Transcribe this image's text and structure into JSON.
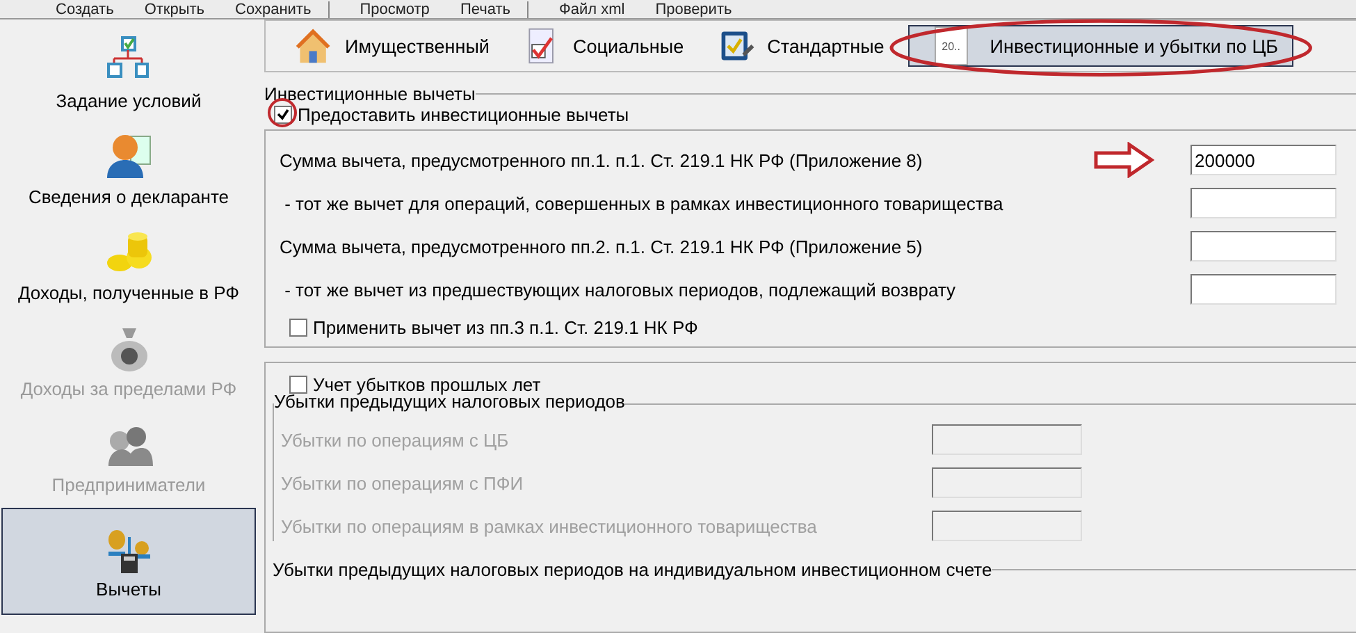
{
  "toolbar": [
    {
      "label": "Создать"
    },
    {
      "label": "Открыть"
    },
    {
      "label": "Сохранить",
      "separator_after": true
    },
    {
      "label": "Просмотр"
    },
    {
      "label": "Печать",
      "separator_after": true
    },
    {
      "label": "Файл xml"
    },
    {
      "label": "Проверить"
    }
  ],
  "sidebar": {
    "items": [
      {
        "label": "Задание условий",
        "selected": false,
        "disabled": false
      },
      {
        "label": "Сведения о декларанте",
        "selected": false,
        "disabled": false
      },
      {
        "label": "Доходы, полученные в РФ",
        "selected": false,
        "disabled": false
      },
      {
        "label": "Доходы за пределами РФ",
        "selected": false,
        "disabled": true
      },
      {
        "label": "Предприниматели",
        "selected": false,
        "disabled": true
      },
      {
        "label": "Вычеты",
        "selected": true,
        "disabled": false
      }
    ]
  },
  "tabs": [
    {
      "label": "Имущественный",
      "selected": false,
      "circled": false
    },
    {
      "label": "Социальные",
      "selected": false,
      "circled": false
    },
    {
      "label": "Стандартные",
      "selected": false,
      "circled": false
    },
    {
      "label": "Инвестиционные и убытки по ЦБ",
      "icon_text": "20..",
      "selected": true,
      "circled": true
    }
  ],
  "investment": {
    "title": "Инвестиционные вычеты",
    "checkbox": {
      "label": "Предоставить инвестиционные вычеты",
      "checked": true,
      "circled": true
    },
    "rows": [
      {
        "label": "Сумма вычета, предусмотренного пп.1. п.1. Ст. 219.1 НК РФ (Приложение 8)",
        "value": "200000",
        "arrow": true
      },
      {
        "label": " - тот же вычет для операций, совершенных в рамках инвестиционного товарищества",
        "arrow": false
      },
      {
        "label": "Сумма вычета, предусмотренного пп.2. п.1. Ст. 219.1 НК РФ (Приложение 5)",
        "arrow": false
      },
      {
        "label": " - тот же вычет из предшествующих налоговых периодов, подлежащий возврату",
        "arrow": false
      }
    ],
    "option": {
      "label": "Применить вычет из пп.3 п.1. Ст. 219.1 НК РФ",
      "checked": false
    }
  },
  "losses": {
    "checkbox": {
      "label": "Учет убытков прошлых лет",
      "checked": false
    },
    "group": {
      "title": "Убытки предыдущих налоговых периодов",
      "disabled": true,
      "rows": [
        {
          "label": "Убытки по операциям с ЦБ"
        },
        {
          "label": "Убытки по операциям с ПФИ"
        },
        {
          "label": "Убытки по операциям в рамках инвестиционного товарищества"
        }
      ]
    },
    "next_group_title": "Убытки предыдущих налоговых периодов на индивидуальном инвестиционном счете"
  }
}
